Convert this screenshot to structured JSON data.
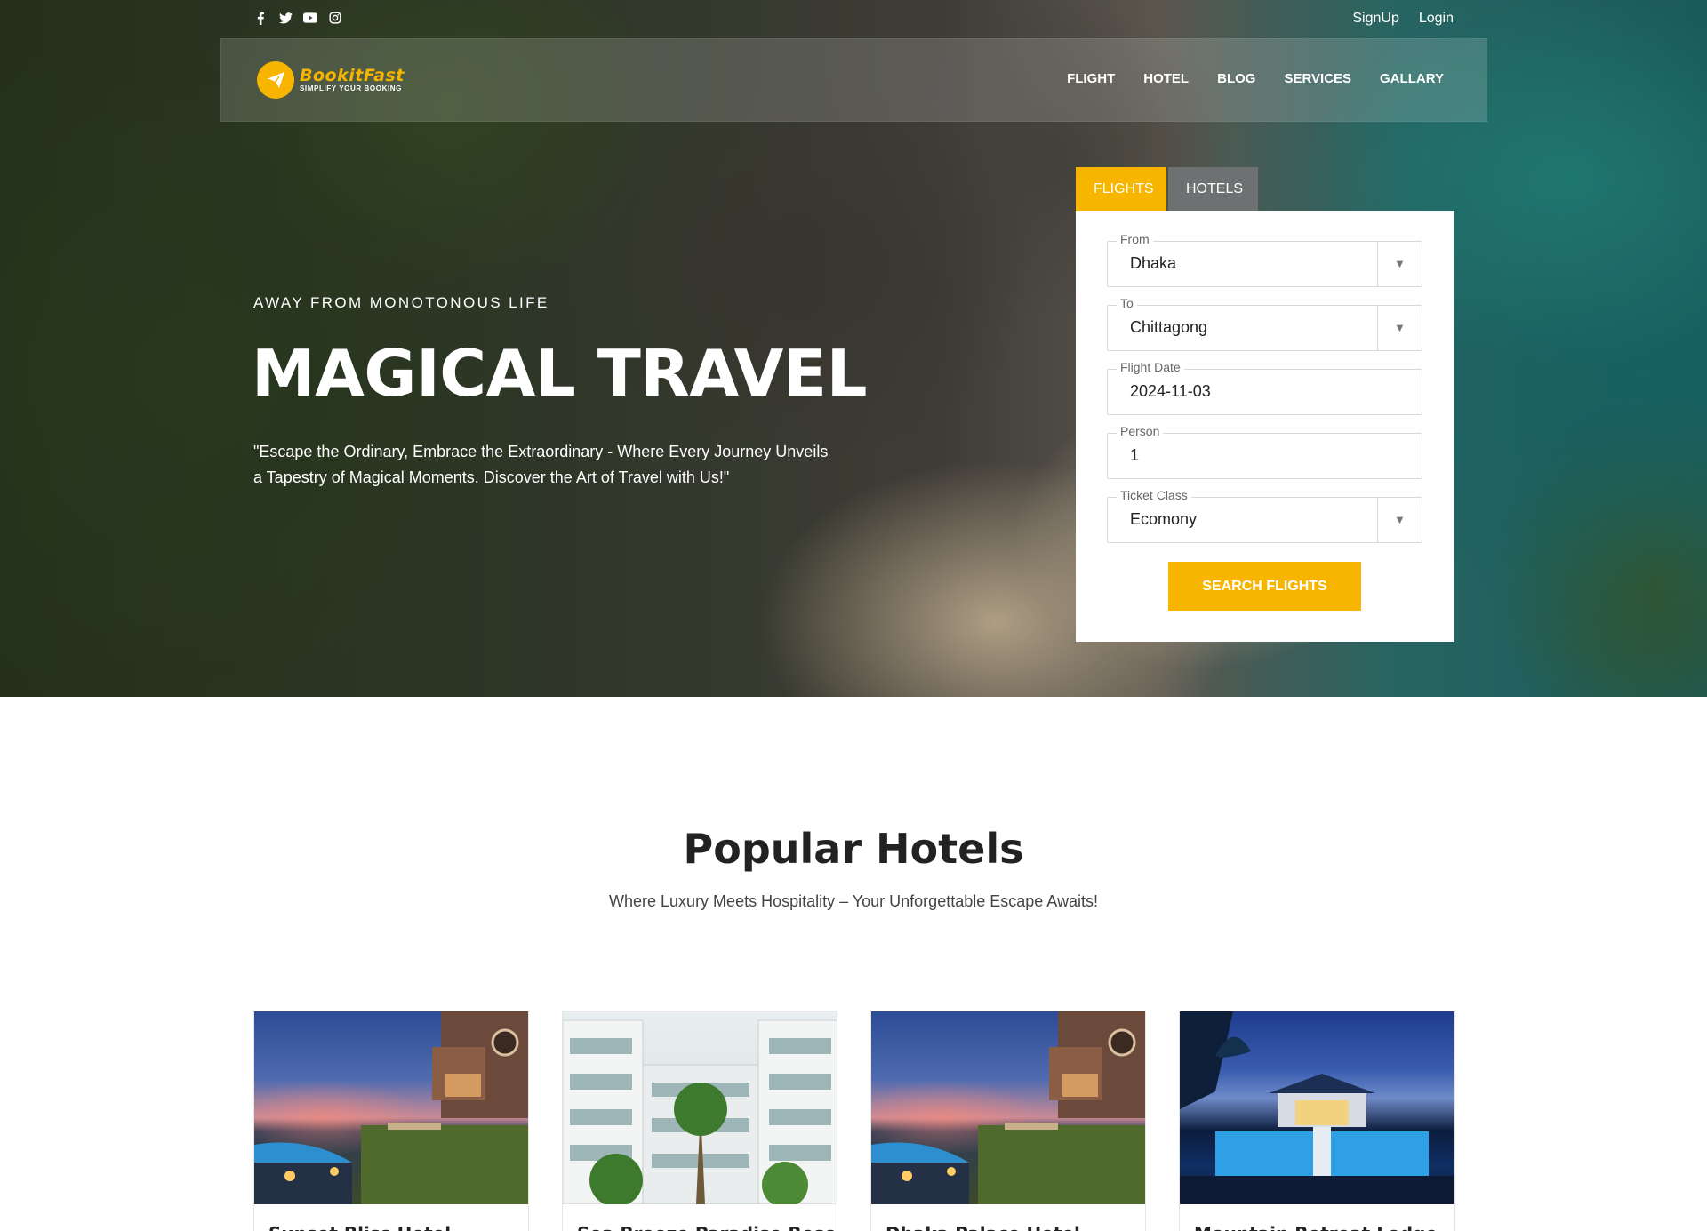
{
  "topbar": {
    "socials": [
      {
        "icon": "facebook-icon",
        "glyph": "f"
      },
      {
        "icon": "twitter-icon",
        "glyph": "t"
      },
      {
        "icon": "youtube-icon",
        "glyph": "▶"
      },
      {
        "icon": "instagram-icon",
        "glyph": "◎"
      }
    ],
    "signup": "SignUp",
    "login": "Login"
  },
  "brand": {
    "name": "BookitFast",
    "tagline": "SIMPLIFY YOUR BOOKING",
    "accent": "#f7b500"
  },
  "nav": {
    "items": [
      "FLIGHT",
      "HOTEL",
      "BLOG",
      "SERVICES",
      "GALLARY"
    ]
  },
  "hero": {
    "eyebrow": "AWAY FROM MONOTONOUS LIFE",
    "title": "MAGICAL TRAVEL",
    "tagline": "\"Escape the Ordinary, Embrace the Extraordinary - Where Every Journey Unveils a Tapestry of Magical Moments. Discover the Art of Travel with Us!\""
  },
  "booking": {
    "tabs": [
      "FLIGHTS",
      "HOTELS"
    ],
    "active_tab": "FLIGHTS",
    "fields": {
      "from": {
        "label": "From",
        "value": "Dhaka"
      },
      "to": {
        "label": "To",
        "value": "Chittagong"
      },
      "date": {
        "label": "Flight Date",
        "value": "2024-11-03"
      },
      "person": {
        "label": "Person",
        "value": "1"
      },
      "class": {
        "label": "Ticket Class",
        "value": "Ecomony"
      }
    },
    "search_label": "SEARCH FLIGHTS"
  },
  "popular": {
    "title": "Popular Hotels",
    "subtitle": "Where Luxury Meets Hospitality – Your Unforgettable Escape Awaits!",
    "cards": [
      {
        "name": "Sunset Bliss Hotel",
        "image": "dusk"
      },
      {
        "name": "Sea Breeze Paradise Resort",
        "image": "building"
      },
      {
        "name": "Dhaka Palace Hotel",
        "image": "dusk"
      },
      {
        "name": "Mountain Retreat Lodge",
        "image": "night"
      }
    ]
  }
}
